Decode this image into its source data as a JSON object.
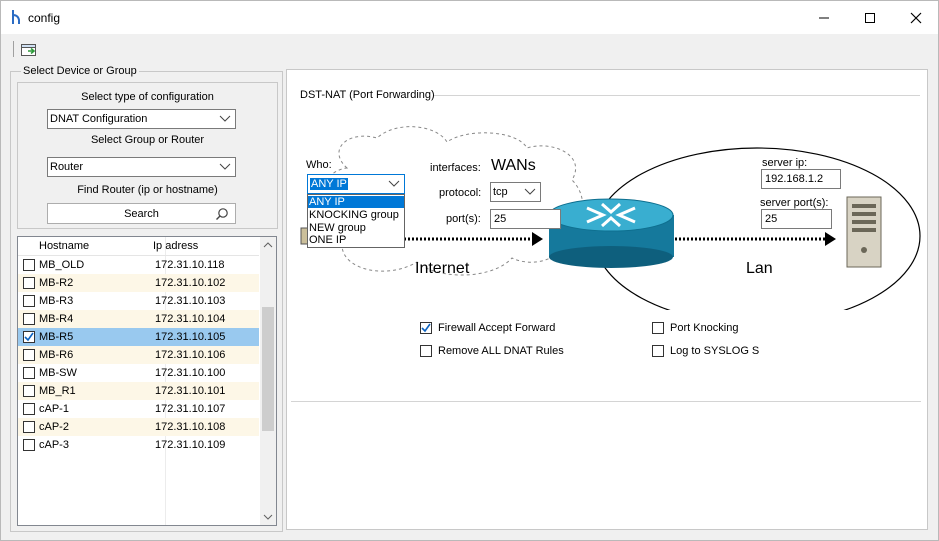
{
  "window": {
    "title": "config",
    "icon": "app-fork-icon",
    "controls": [
      "minimize-icon",
      "maximize-icon",
      "close-icon"
    ]
  },
  "toolbar": {
    "items": [
      "open-config-icon"
    ]
  },
  "left_panel": {
    "group_label": "Select Device or Group",
    "config_type_label": "Select type of configuration",
    "config_type_value": "DNAT Configuration",
    "group_router_label": "Select Group or Router",
    "group_router_value": "Router",
    "find_router_label": "Find Router (ip or hostname)",
    "search_label": "Search"
  },
  "device_table": {
    "columns": [
      "Hostname",
      "Ip adress"
    ],
    "rows": [
      {
        "hostname": "MB_OLD",
        "ip": "172.31.10.118",
        "checked": false
      },
      {
        "hostname": "MB-R2",
        "ip": "172.31.10.102",
        "checked": false
      },
      {
        "hostname": "MB-R3",
        "ip": "172.31.10.103",
        "checked": false
      },
      {
        "hostname": "MB-R4",
        "ip": "172.31.10.104",
        "checked": false
      },
      {
        "hostname": "MB-R5",
        "ip": "172.31.10.105",
        "checked": true
      },
      {
        "hostname": "MB-R6",
        "ip": "172.31.10.106",
        "checked": false
      },
      {
        "hostname": "MB-SW",
        "ip": "172.31.10.100",
        "checked": false
      },
      {
        "hostname": "MB_R1",
        "ip": "172.31.10.101",
        "checked": false
      },
      {
        "hostname": "cAP-1",
        "ip": "172.31.10.107",
        "checked": false
      },
      {
        "hostname": "cAP-2",
        "ip": "172.31.10.108",
        "checked": false
      },
      {
        "hostname": "cAP-3",
        "ip": "172.31.10.109",
        "checked": false
      }
    ],
    "selected_index": 4
  },
  "dnat": {
    "section_label": "DST-NAT (Port Forwarding)",
    "who_label": "Who:",
    "who_value": "ANY IP",
    "who_options": [
      "ANY IP",
      "KNOCKING group",
      "NEW group",
      "ONE IP"
    ],
    "interfaces_label": "interfaces:",
    "interfaces_value": "WANs",
    "protocol_label": "protocol:",
    "protocol_value": "tcp",
    "ports_label": "port(s):",
    "ports_value": "25",
    "internet_label": "Internet",
    "lan_label": "Lan",
    "server_ip_label": "server ip:",
    "server_ip_value": "192.168.1.2",
    "server_ports_label": "server port(s):",
    "server_ports_value": "25",
    "options": {
      "firewall_accept": {
        "label": "Firewall Accept Forward",
        "checked": true
      },
      "remove_all": {
        "label": "Remove ALL DNAT Rules",
        "checked": false
      },
      "port_knocking": {
        "label": "Port Knocking",
        "checked": false
      },
      "log_syslog": {
        "label": "Log to SYSLOG S",
        "checked": false
      }
    }
  },
  "colors": {
    "selection": "#99c9ef",
    "dropdown_highlight": "#0078d7",
    "router": "#1b8fb3",
    "check": "#0b63c1"
  }
}
